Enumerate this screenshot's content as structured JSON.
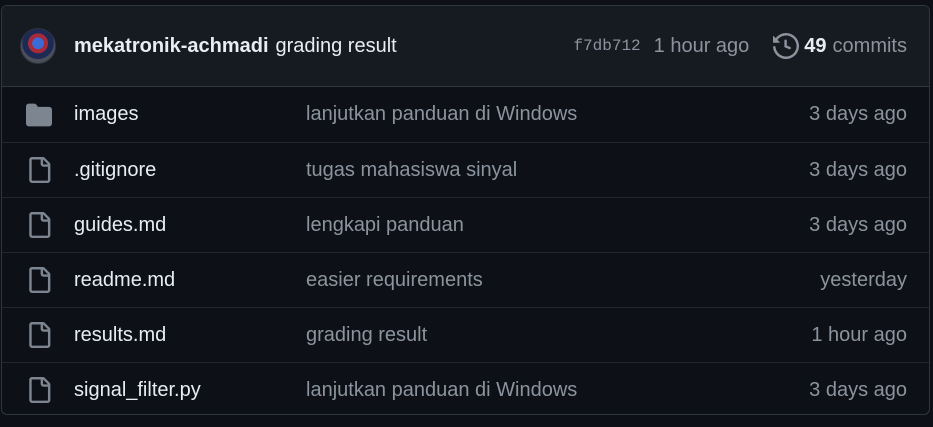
{
  "latest_commit": {
    "author": "mekatronik-achmadi",
    "message": "grading result",
    "sha": "f7db712",
    "time": "1 hour ago",
    "commit_count": "49",
    "commits_label": "commits",
    "history_icon": "history-icon",
    "avatar_icon": "user-avatar"
  },
  "files": [
    {
      "type": "folder",
      "icon": "folder-icon",
      "name": "images",
      "message": "lanjutkan panduan di Windows",
      "time": "3 days ago"
    },
    {
      "type": "file",
      "icon": "file-icon",
      "name": ".gitignore",
      "message": "tugas mahasiswa sinyal",
      "time": "3 days ago"
    },
    {
      "type": "file",
      "icon": "file-icon",
      "name": "guides.md",
      "message": "lengkapi panduan",
      "time": "3 days ago"
    },
    {
      "type": "file",
      "icon": "file-icon",
      "name": "readme.md",
      "message": "easier requirements",
      "time": "yesterday"
    },
    {
      "type": "file",
      "icon": "file-icon",
      "name": "results.md",
      "message": "grading result",
      "time": "1 hour ago"
    },
    {
      "type": "file",
      "icon": "file-icon",
      "name": "signal_filter.py",
      "message": "lanjutkan panduan di Windows",
      "time": "3 days ago"
    }
  ],
  "colors": {
    "background": "#0d1117",
    "header_background": "#161b22",
    "border": "#30363d",
    "text_primary": "#e6edf3",
    "text_muted": "#8b949e",
    "icon": "#7d8590"
  }
}
